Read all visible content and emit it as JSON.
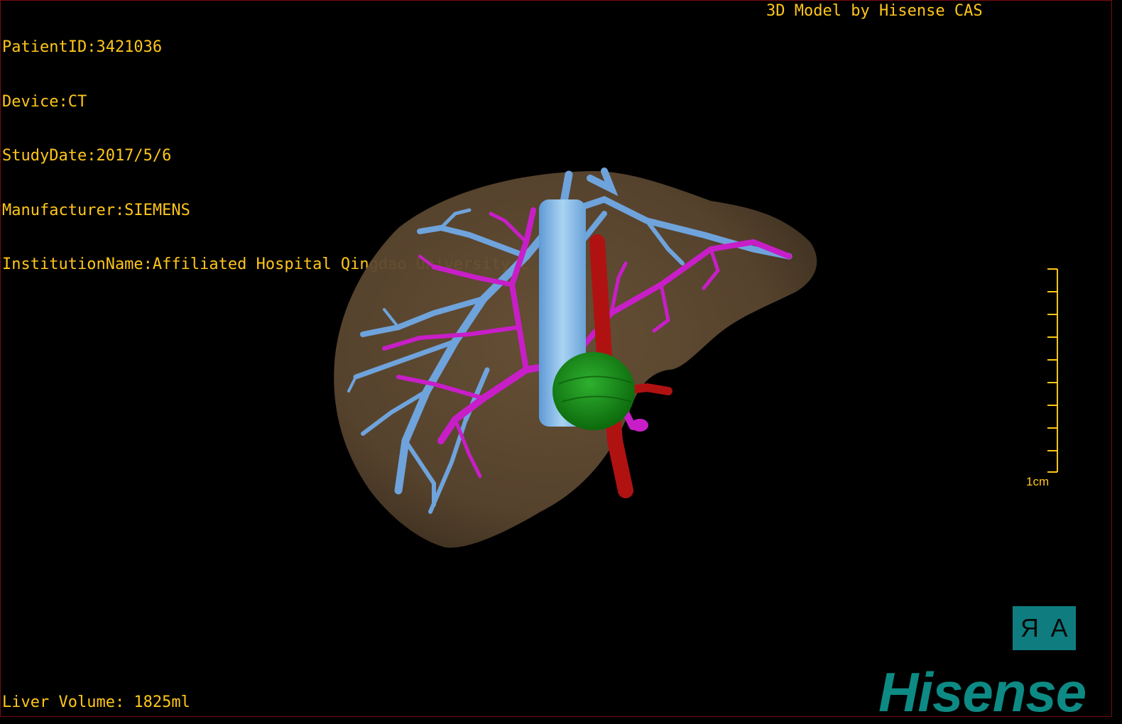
{
  "info": {
    "patient_id": "PatientID:3421036",
    "device": "Device:CT",
    "study_date": "StudyDate:2017/5/6",
    "manufacturer": "Manufacturer:SIEMENS",
    "institution": "InstitutionName:Affiliated Hospital Qingdao University-C"
  },
  "credit": "3D Model by Hisense CAS",
  "volume": "Liver Volume: 1825ml",
  "scale_label": "1cm",
  "orientation": {
    "left_glyph": "R",
    "right_glyph": "A"
  },
  "logo": "Hisense",
  "colors": {
    "text": "#ffc61a",
    "liver": "#6b5338",
    "hepatic_vein": "#6fa3dc",
    "portal_vein": "#c81ec8",
    "artery": "#b01212",
    "lesion": "#1a8f1a",
    "vena_cava": "#8cc1ea",
    "brand": "#0d8a84"
  },
  "structures": [
    "liver",
    "hepatic-vein",
    "portal-vein",
    "artery",
    "lesion",
    "vena-cava"
  ]
}
